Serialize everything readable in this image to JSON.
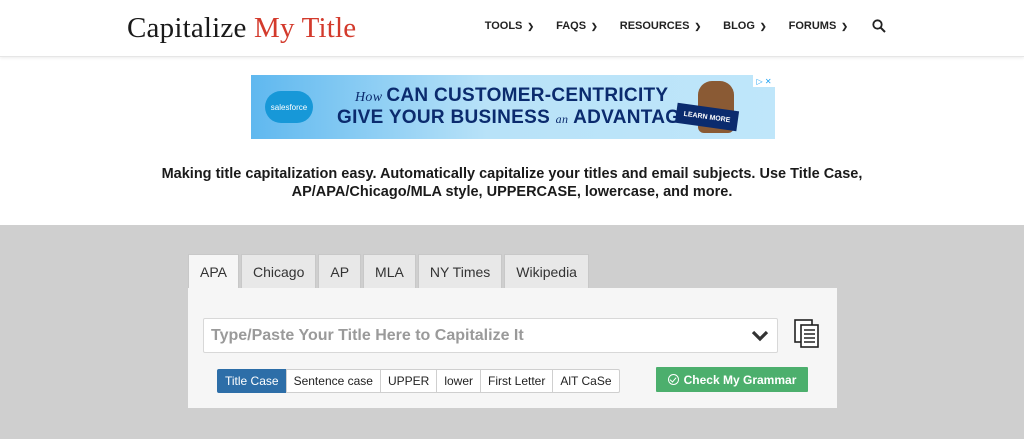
{
  "header": {
    "logo_part1": "Capitalize ",
    "logo_part2": "My Title",
    "nav": [
      {
        "label": "TOOLS"
      },
      {
        "label": "FAQS"
      },
      {
        "label": "RESOURCES"
      },
      {
        "label": "BLOG"
      },
      {
        "label": "FORUMS"
      }
    ],
    "search_icon": "search-icon"
  },
  "ad": {
    "brand": "salesforce",
    "line1_prefix": "How",
    "line1": "CAN CUSTOMER-CENTRICITY",
    "line2_a": "GIVE YOUR BUSINESS",
    "line2_an": "an",
    "line2_b": "ADVANTAGE?",
    "cta": "LEARN MORE",
    "adchoices": "▷ ✕"
  },
  "tagline": "Making title capitalization easy. Automatically capitalize your titles and email subjects. Use Title Case, AP/APA/Chicago/MLA style, UPPERCASE, lowercase, and more.",
  "tabs": [
    {
      "label": "APA",
      "active": true
    },
    {
      "label": "Chicago"
    },
    {
      "label": "AP"
    },
    {
      "label": "MLA"
    },
    {
      "label": "NY Times"
    },
    {
      "label": "Wikipedia"
    }
  ],
  "input": {
    "placeholder": "Type/Paste Your Title Here to Capitalize It"
  },
  "case_buttons": [
    {
      "label": "Title Case",
      "active": true
    },
    {
      "label": "Sentence case"
    },
    {
      "label": "UPPER"
    },
    {
      "label": "lower"
    },
    {
      "label": "First Letter"
    },
    {
      "label": "AlT CaSe"
    }
  ],
  "grammar_button": "Check My Grammar",
  "colors": {
    "logo_accent": "#d33a2c",
    "active_case": "#2d6ea8",
    "grammar_green": "#4caf6d",
    "gray_band": "#cfcfcf"
  }
}
